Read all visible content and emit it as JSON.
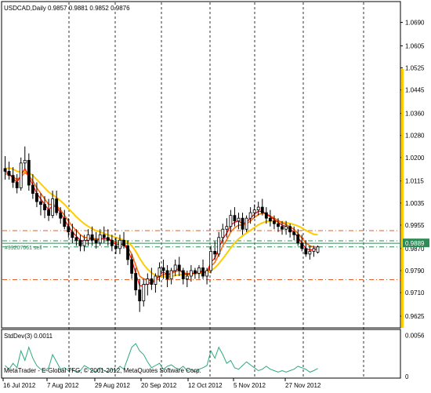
{
  "app": {
    "title": "MetaTrader - E-Global TFG, © 2001-2012, MetaQuotes Software Corp."
  },
  "header": {
    "symbol_line": "USDCAD,Daily  0.9857 0.9881 0.9852 0.9876"
  },
  "indicator": {
    "label": "StdDev(3) 0.0011"
  },
  "order_label": "#99207061 sell",
  "colors": {
    "background": "#ffffff",
    "axis": "#000000",
    "candle": "#000000",
    "ma_fast": "#ff0000",
    "ma_mid": "#ff6600",
    "ma_slow": "#ffcc00",
    "level_red": "#e06030",
    "level_green": "#2e8b57",
    "bid_line": "#2e8b57",
    "stddev": "#2eaa7a",
    "price_tag_bg": "#2e8b57",
    "price_tag_text": "#ffffff",
    "scroll_bar": "#ffcc00"
  },
  "chart_data": [
    {
      "type": "candlestick",
      "title": "USDCAD,Daily",
      "ohlc_readout": {
        "open": 0.9857,
        "high": 0.9881,
        "low": 0.9852,
        "close": 0.9876
      },
      "y_ticks": [
        "1.0690",
        "1.0605",
        "1.0525",
        "1.0445",
        "1.0360",
        "1.0280",
        "1.0200",
        "1.0115",
        "1.0035",
        "0.9955",
        "0.9870",
        "0.9790",
        "0.9710",
        "0.9625"
      ],
      "ylim": [
        0.9605,
        1.072
      ],
      "x_ticks": [
        "16 Jul 2012",
        "7 Aug 2012",
        "29 Aug 2012",
        "20 Sep 2012",
        "12 Oct 2012",
        "5 Nov 2012",
        "27 Nov 2012"
      ],
      "current_price": "0.9889",
      "levels": [
        {
          "price": 0.9935,
          "style": "dash-dot",
          "color": "red"
        },
        {
          "price": 0.9898,
          "style": "dash-dot",
          "color": "green"
        },
        {
          "price": 0.9876,
          "style": "dash-dot",
          "color": "green"
        },
        {
          "price": 0.9757,
          "style": "dash-dot",
          "color": "red"
        }
      ],
      "ohlc": [
        [
          1.016,
          1.0205,
          1.012,
          1.015
        ],
        [
          1.015,
          1.0185,
          1.012,
          1.0135
        ],
        [
          1.0135,
          1.0165,
          1.009,
          1.011
        ],
        [
          1.011,
          1.014,
          1.007,
          1.009
        ],
        [
          1.009,
          1.02,
          1.008,
          1.018
        ],
        [
          1.018,
          1.024,
          1.016,
          1.019
        ],
        [
          1.019,
          1.0215,
          1.008,
          1.01
        ],
        [
          1.01,
          1.014,
          1.005,
          1.007
        ],
        [
          1.007,
          1.011,
          1.002,
          1.004
        ],
        [
          1.004,
          1.007,
          0.999,
          1.003
        ],
        [
          1.003,
          1.006,
          0.998,
          1.001
        ],
        [
          1.001,
          1.005,
          0.997,
          0.999
        ],
        [
          0.999,
          1.008,
          0.998,
          1.005
        ],
        [
          1.005,
          1.008,
          0.999,
          1.0
        ],
        [
          1.0,
          1.002,
          0.996,
          0.998
        ],
        [
          0.998,
          1.001,
          0.994,
          0.995
        ],
        [
          0.995,
          0.998,
          0.991,
          0.993
        ],
        [
          0.993,
          0.996,
          0.989,
          0.991
        ],
        [
          0.991,
          0.994,
          0.988,
          0.99
        ],
        [
          0.99,
          0.992,
          0.986,
          0.988
        ],
        [
          0.988,
          0.992,
          0.986,
          0.99
        ],
        [
          0.99,
          0.994,
          0.988,
          0.992
        ],
        [
          0.992,
          0.995,
          0.988,
          0.99
        ],
        [
          0.99,
          0.993,
          0.987,
          0.989
        ],
        [
          0.989,
          0.994,
          0.988,
          0.992
        ],
        [
          0.992,
          0.995,
          0.989,
          0.991
        ],
        [
          0.991,
          0.994,
          0.988,
          0.99
        ],
        [
          0.99,
          0.992,
          0.986,
          0.988
        ],
        [
          0.988,
          0.991,
          0.985,
          0.987
        ],
        [
          0.987,
          0.992,
          0.985,
          0.99
        ],
        [
          0.99,
          0.993,
          0.987,
          0.988
        ],
        [
          0.988,
          0.99,
          0.981,
          0.983
        ],
        [
          0.983,
          0.985,
          0.976,
          0.978
        ],
        [
          0.978,
          0.98,
          0.97,
          0.972
        ],
        [
          0.972,
          0.976,
          0.964,
          0.968
        ],
        [
          0.968,
          0.976,
          0.966,
          0.974
        ],
        [
          0.974,
          0.978,
          0.97,
          0.976
        ],
        [
          0.976,
          0.98,
          0.972,
          0.974
        ],
        [
          0.974,
          0.978,
          0.971,
          0.977
        ],
        [
          0.977,
          0.982,
          0.975,
          0.98
        ],
        [
          0.98,
          0.983,
          0.976,
          0.979
        ],
        [
          0.979,
          0.981,
          0.973,
          0.976
        ],
        [
          0.976,
          0.98,
          0.974,
          0.979
        ],
        [
          0.979,
          0.983,
          0.977,
          0.981
        ],
        [
          0.981,
          0.984,
          0.977,
          0.979
        ],
        [
          0.979,
          0.98,
          0.974,
          0.976
        ],
        [
          0.976,
          0.979,
          0.973,
          0.977
        ],
        [
          0.977,
          0.981,
          0.975,
          0.979
        ],
        [
          0.979,
          0.98,
          0.976,
          0.978
        ],
        [
          0.978,
          0.981,
          0.976,
          0.98
        ],
        [
          0.98,
          0.983,
          0.976,
          0.977
        ],
        [
          0.977,
          0.98,
          0.974,
          0.979
        ],
        [
          0.979,
          0.988,
          0.978,
          0.986
        ],
        [
          0.986,
          0.99,
          0.983,
          0.985
        ],
        [
          0.985,
          0.993,
          0.984,
          0.991
        ],
        [
          0.991,
          0.996,
          0.989,
          0.994
        ],
        [
          0.994,
          0.998,
          0.991,
          0.995
        ],
        [
          0.995,
          1.001,
          0.993,
          0.999
        ],
        [
          0.999,
          1.002,
          0.995,
          0.997
        ],
        [
          0.997,
          1.0,
          0.994,
          0.998
        ],
        [
          0.998,
          1.0,
          0.992,
          0.994
        ],
        [
          0.994,
          0.999,
          0.993,
          0.998
        ],
        [
          0.998,
          1.002,
          0.996,
          1.0
        ],
        [
          1.0,
          1.003,
          0.998,
          1.001
        ],
        [
          1.001,
          1.004,
          0.999,
          1.002
        ],
        [
          1.002,
          1.005,
          0.999,
          1.0
        ],
        [
          1.0,
          1.002,
          0.996,
          0.998
        ],
        [
          0.998,
          1.001,
          0.995,
          0.997
        ],
        [
          0.997,
          0.999,
          0.994,
          0.996
        ],
        [
          0.996,
          0.998,
          0.993,
          0.995
        ],
        [
          0.995,
          0.997,
          0.992,
          0.994
        ],
        [
          0.994,
          0.997,
          0.992,
          0.995
        ],
        [
          0.995,
          0.996,
          0.991,
          0.993
        ],
        [
          0.993,
          0.995,
          0.99,
          0.992
        ],
        [
          0.992,
          0.994,
          0.988,
          0.989
        ],
        [
          0.989,
          0.992,
          0.986,
          0.987
        ],
        [
          0.987,
          0.99,
          0.984,
          0.985
        ],
        [
          0.985,
          0.988,
          0.983,
          0.986
        ],
        [
          0.986,
          0.988,
          0.984,
          0.987
        ],
        [
          0.9857,
          0.9881,
          0.9852,
          0.9876
        ]
      ],
      "ma_fast": [
        1.015,
        1.014,
        1.0125,
        1.011,
        1.0135,
        1.016,
        1.013,
        1.01,
        1.007,
        1.005,
        1.003,
        1.001,
        1.0025,
        1.002,
        1.0,
        0.9975,
        0.995,
        0.993,
        0.9915,
        0.99,
        0.9895,
        0.9905,
        0.9905,
        0.99,
        0.9905,
        0.9905,
        0.9905,
        0.9895,
        0.9885,
        0.9885,
        0.9885,
        0.9865,
        0.983,
        0.978,
        0.9735,
        0.9735,
        0.9745,
        0.9745,
        0.9755,
        0.9775,
        0.9785,
        0.9775,
        0.978,
        0.9795,
        0.9795,
        0.978,
        0.9775,
        0.978,
        0.978,
        0.979,
        0.9785,
        0.9785,
        0.982,
        0.9835,
        0.987,
        0.9905,
        0.9925,
        0.9955,
        0.9965,
        0.997,
        0.996,
        0.9965,
        0.998,
        0.9995,
        1.0005,
        1.0005,
        0.9995,
        0.9985,
        0.9975,
        0.9965,
        0.9955,
        0.995,
        0.994,
        0.993,
        0.991,
        0.989,
        0.987,
        0.9865,
        0.9865,
        0.987
      ],
      "ma_mid": [
        1.014,
        1.014,
        1.013,
        1.012,
        1.013,
        1.0145,
        1.0135,
        1.0115,
        1.009,
        1.007,
        1.005,
        1.003,
        1.003,
        1.0025,
        1.001,
        0.999,
        0.997,
        0.995,
        0.9935,
        0.992,
        0.991,
        0.991,
        0.9908,
        0.9905,
        0.9906,
        0.9906,
        0.9906,
        0.99,
        0.9893,
        0.989,
        0.9888,
        0.9875,
        0.985,
        0.981,
        0.977,
        0.976,
        0.9757,
        0.9753,
        0.9757,
        0.9768,
        0.9776,
        0.9775,
        0.9778,
        0.9787,
        0.979,
        0.9783,
        0.9779,
        0.978,
        0.978,
        0.9786,
        0.9784,
        0.9784,
        0.9805,
        0.982,
        0.9848,
        0.988,
        0.9902,
        0.993,
        0.9945,
        0.9955,
        0.9955,
        0.996,
        0.997,
        0.9983,
        0.9993,
        0.9998,
        0.9995,
        0.9988,
        0.998,
        0.9972,
        0.9963,
        0.9957,
        0.9948,
        0.994,
        0.9925,
        0.9908,
        0.989,
        0.988,
        0.9876,
        0.9874
      ],
      "ma_slow": [
        1.016,
        1.0162,
        1.0158,
        1.015,
        1.0148,
        1.015,
        1.0145,
        1.0135,
        1.012,
        1.0105,
        1.009,
        1.0075,
        1.0065,
        1.0055,
        1.0043,
        1.003,
        1.0015,
        1.0,
        0.9985,
        0.9972,
        0.996,
        0.995,
        0.9942,
        0.9935,
        0.993,
        0.9925,
        0.992,
        0.9915,
        0.991,
        0.9905,
        0.99,
        0.9893,
        0.988,
        0.986,
        0.9835,
        0.9812,
        0.9795,
        0.9782,
        0.9773,
        0.9768,
        0.9768,
        0.9768,
        0.977,
        0.9772,
        0.9775,
        0.9776,
        0.9776,
        0.9777,
        0.9778,
        0.978,
        0.9782,
        0.9783,
        0.979,
        0.98,
        0.9815,
        0.9833,
        0.9852,
        0.9872,
        0.989,
        0.9905,
        0.9916,
        0.9926,
        0.9936,
        0.9946,
        0.9956,
        0.9963,
        0.9968,
        0.997,
        0.997,
        0.9968,
        0.9966,
        0.9964,
        0.9961,
        0.9957,
        0.9952,
        0.9945,
        0.9936,
        0.9928,
        0.9922,
        0.992
      ],
      "stddev_ylim": [
        0,
        0.006
      ],
      "stddev_ticks": [
        "0.0056",
        "0"
      ],
      "stddev": [
        0.0015,
        0.001,
        0.0018,
        0.0012,
        0.0035,
        0.0022,
        0.004,
        0.0025,
        0.0015,
        0.001,
        0.0008,
        0.0012,
        0.003,
        0.002,
        0.001,
        0.0012,
        0.0008,
        0.001,
        0.0006,
        0.0008,
        0.0015,
        0.0012,
        0.0008,
        0.0006,
        0.0012,
        0.0008,
        0.0006,
        0.001,
        0.0008,
        0.0014,
        0.001,
        0.0025,
        0.004,
        0.0045,
        0.0035,
        0.003,
        0.002,
        0.0012,
        0.0015,
        0.0018,
        0.001,
        0.0014,
        0.0016,
        0.0012,
        0.001,
        0.0014,
        0.0008,
        0.001,
        0.0006,
        0.001,
        0.0012,
        0.0015,
        0.0035,
        0.0025,
        0.004,
        0.003,
        0.0018,
        0.0022,
        0.0012,
        0.001,
        0.0015,
        0.002,
        0.0016,
        0.0012,
        0.0008,
        0.001,
        0.0014,
        0.001,
        0.0008,
        0.0006,
        0.0008,
        0.0006,
        0.0008,
        0.001,
        0.0014,
        0.0012,
        0.001,
        0.0006,
        0.0008,
        0.0011
      ]
    }
  ]
}
